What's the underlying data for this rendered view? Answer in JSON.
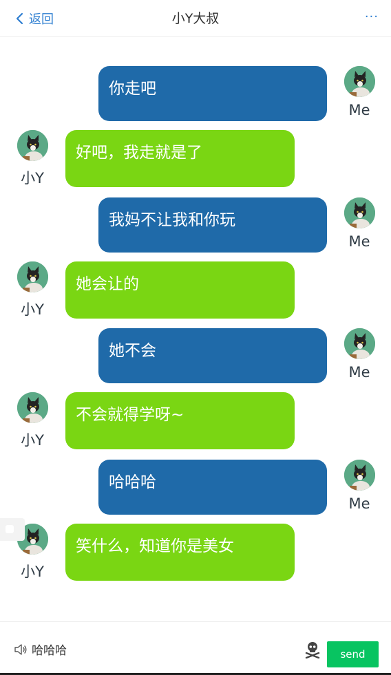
{
  "header": {
    "back_label": "返回",
    "title": "小Y大叔",
    "more_label": "···"
  },
  "messages": [
    {
      "sender": "me",
      "name": "Me",
      "text": "你走吧"
    },
    {
      "sender": "her",
      "name": "小Y",
      "text": "好吧，我走就是了"
    },
    {
      "sender": "me",
      "name": "Me",
      "text": "我妈不让我和你玩"
    },
    {
      "sender": "her",
      "name": "小Y",
      "text": "她会让的"
    },
    {
      "sender": "me",
      "name": "Me",
      "text": "她不会"
    },
    {
      "sender": "her",
      "name": "小Y",
      "text": "不会就得学呀~"
    },
    {
      "sender": "me",
      "name": "Me",
      "text": "哈哈哈"
    },
    {
      "sender": "her",
      "name": "小Y",
      "text": "笑什么，知道你是美女"
    }
  ],
  "footer": {
    "input_text": "哈哈哈",
    "send_label": "send"
  },
  "colors": {
    "me_bubble": "#1f6aa9",
    "her_bubble": "#7ad613",
    "accent": "#2f7fd1",
    "send_button": "#08c461"
  },
  "icons": {
    "back": "chevron-left-icon",
    "voice": "speaker-icon",
    "emoji": "skull-crossbones-icon"
  }
}
